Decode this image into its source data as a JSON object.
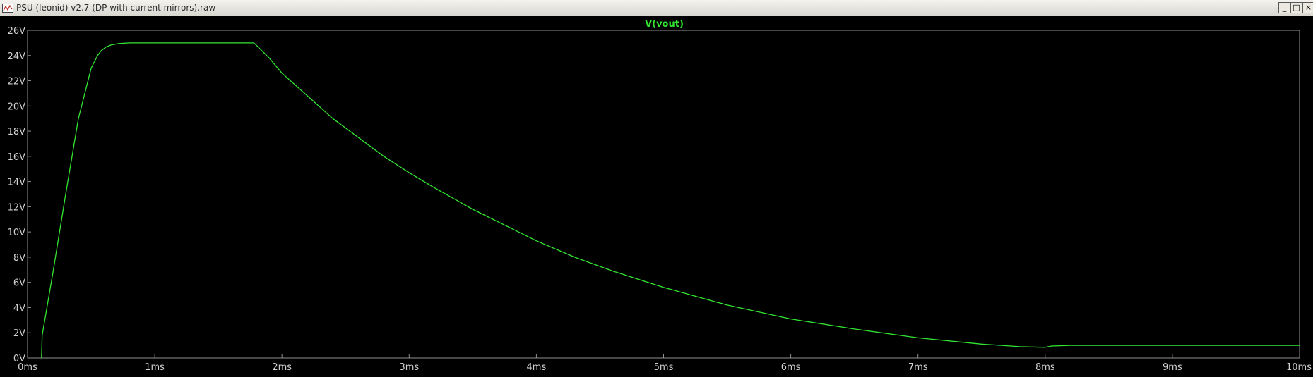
{
  "window": {
    "title": "PSU (leonid) v2.7 (DP with current mirrors).raw",
    "minimize_label": "_",
    "maximize_label": "□",
    "close_label": "×"
  },
  "colors": {
    "plot_background": "#000000",
    "trace": "#32e632",
    "grid_axes": "#909090",
    "tick_text": "#d0d0d0"
  },
  "chart_data": {
    "type": "line",
    "title": "V(vout)",
    "xlabel": "",
    "ylabel": "",
    "xlim": [
      0,
      10
    ],
    "ylim": [
      0,
      26
    ],
    "x_ticks": [
      "0ms",
      "1ms",
      "2ms",
      "3ms",
      "4ms",
      "5ms",
      "6ms",
      "7ms",
      "8ms",
      "9ms",
      "10ms"
    ],
    "y_ticks": [
      "0V",
      "2V",
      "4V",
      "6V",
      "8V",
      "10V",
      "12V",
      "14V",
      "16V",
      "18V",
      "20V",
      "22V",
      "24V",
      "26V"
    ],
    "grid": false,
    "series": [
      {
        "name": "V(vout)",
        "x": [
          0.11,
          0.115,
          0.2,
          0.3,
          0.4,
          0.5,
          0.55,
          0.58,
          0.62,
          0.66,
          0.72,
          0.8,
          1.0,
          1.2,
          1.5,
          1.78,
          1.9,
          2.0,
          2.2,
          2.4,
          2.6,
          2.8,
          3.0,
          3.2,
          3.5,
          3.8,
          4.0,
          4.3,
          4.6,
          5.0,
          5.5,
          6.0,
          6.5,
          7.0,
          7.5,
          7.8,
          8.0,
          8.05,
          8.2,
          8.5,
          9.0,
          9.5,
          10.0
        ],
        "y": [
          0,
          1.8,
          6.8,
          13.0,
          19.0,
          23.0,
          24.0,
          24.4,
          24.7,
          24.85,
          24.95,
          25.0,
          25.0,
          25.0,
          25.0,
          25.0,
          23.8,
          22.6,
          20.8,
          19.0,
          17.5,
          16.0,
          14.7,
          13.5,
          11.8,
          10.3,
          9.3,
          8.0,
          6.9,
          5.6,
          4.2,
          3.1,
          2.3,
          1.6,
          1.1,
          0.9,
          0.85,
          0.95,
          1.0,
          1.0,
          1.0,
          1.0,
          1.0
        ]
      }
    ]
  }
}
